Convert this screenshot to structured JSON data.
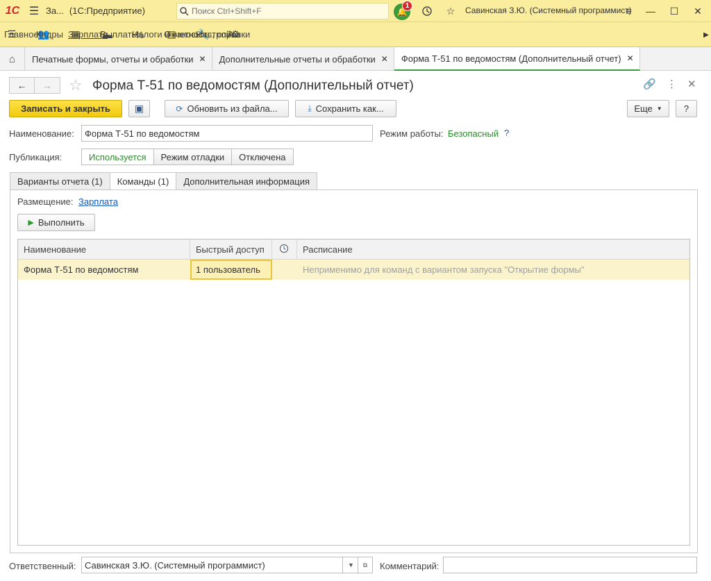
{
  "titlebar": {
    "logo": "1С",
    "app_short": "За...",
    "app_name": "(1С:Предприятие)",
    "search_placeholder": "Поиск Ctrl+Shift+F",
    "notifications_count": "1",
    "user": "Савинская З.Ю. (Системный программист)"
  },
  "sections": [
    {
      "label": "Главное",
      "icon": "menu-icon"
    },
    {
      "label": "Кадры",
      "icon": "people-icon"
    },
    {
      "label": "Зарплата",
      "icon": "calculator-icon"
    },
    {
      "label": "Выплаты",
      "icon": "card-icon"
    },
    {
      "label": "Налоги и взносы",
      "icon": "percent-icon"
    },
    {
      "label": "Отчетность, справки",
      "icon": "report-icon"
    },
    {
      "label": "Настройка",
      "icon": "wrench-icon"
    },
    {
      "label": "А",
      "icon": "gear-icon"
    }
  ],
  "open_tabs": [
    {
      "label": "Печатные формы, отчеты и обработки"
    },
    {
      "label": "Дополнительные отчеты и обработки"
    },
    {
      "label": "Форма Т-51 по ведомостям (Дополнительный отчет)"
    }
  ],
  "form": {
    "title": "Форма Т-51 по ведомостям (Дополнительный отчет)",
    "write_close": "Записать и закрыть",
    "update_from_file": "Обновить из файла...",
    "save_as": "Сохранить как...",
    "more": "Еще",
    "help": "?",
    "name_label": "Наименование:",
    "name_value": "Форма Т-51 по ведомостям",
    "mode_label": "Режим работы:",
    "mode_value": "Безопасный",
    "mode_help": "?",
    "publication_label": "Публикация:",
    "publication_options": [
      "Используется",
      "Режим отладки",
      "Отключена"
    ],
    "tabs": [
      "Варианты отчета (1)",
      "Команды (1)",
      "Дополнительная информация"
    ],
    "placement_label": "Размещение:",
    "placement_value": "Зарплата",
    "execute": "Выполнить",
    "table": {
      "columns": [
        "Наименование",
        "Быстрый доступ",
        "",
        "Расписание"
      ],
      "rows": [
        {
          "name": "Форма Т-51 по ведомостям",
          "quick_access": "1 пользователь",
          "schedule": "Неприменимо для команд с вариантом запуска \"Открытие формы\""
        }
      ]
    },
    "responsible_label": "Ответственный:",
    "responsible_value": "Савинская З.Ю. (Системный программист)",
    "comment_label": "Комментарий:",
    "comment_value": ""
  }
}
